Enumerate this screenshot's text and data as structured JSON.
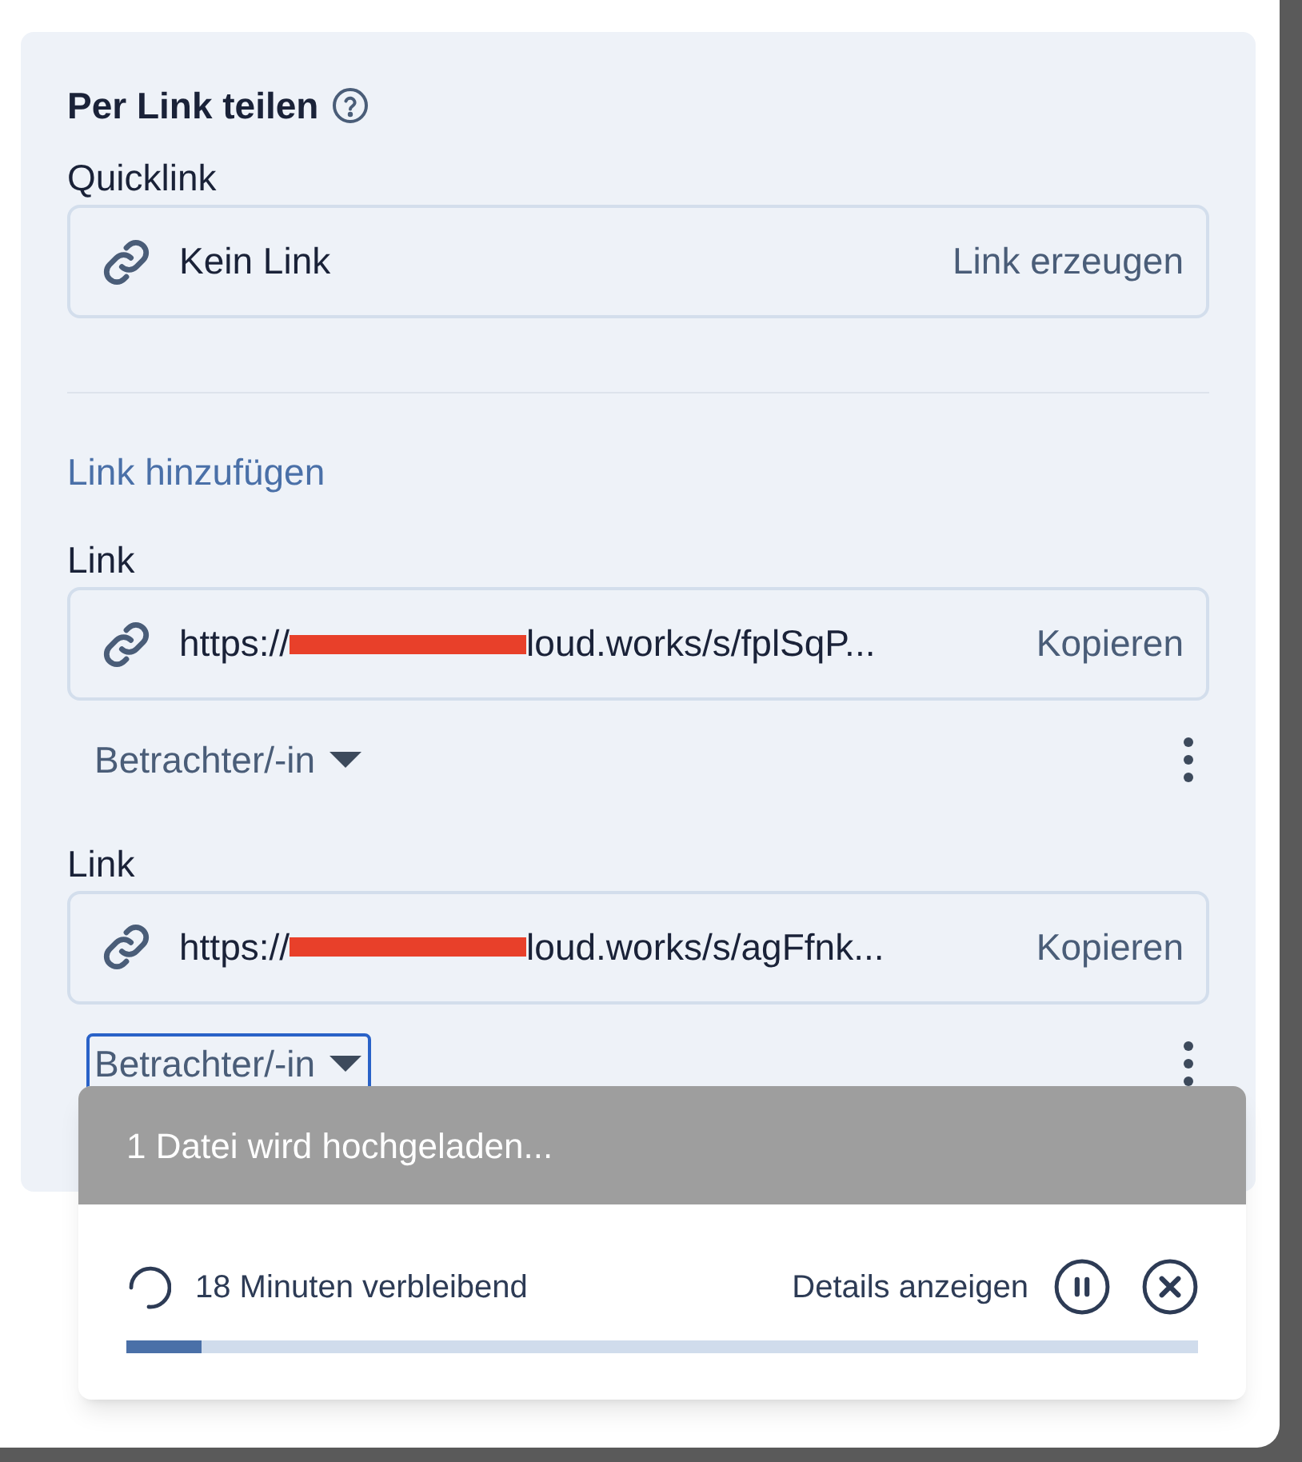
{
  "section": {
    "title": "Per Link teilen"
  },
  "quicklink": {
    "label": "Quicklink",
    "value": "Kein Link",
    "action": "Link erzeugen"
  },
  "add_link": "Link hinzufügen",
  "links": [
    {
      "label": "Link",
      "url_start": "https://",
      "url_end": "loud.works/s/fplSqP...",
      "redacted": true,
      "action": "Kopieren",
      "role": "Betrachter/-in",
      "focused": false
    },
    {
      "label": "Link",
      "url_start": "https://",
      "url_end": "loud.works/s/agFfnk...",
      "redacted": true,
      "action": "Kopieren",
      "role": "Betrachter/-in",
      "focused": true
    }
  ],
  "upload": {
    "title": "1 Datei wird hochgeladen...",
    "remaining": "18 Minuten verbleibend",
    "details": "Details anzeigen",
    "level": 0.07
  }
}
